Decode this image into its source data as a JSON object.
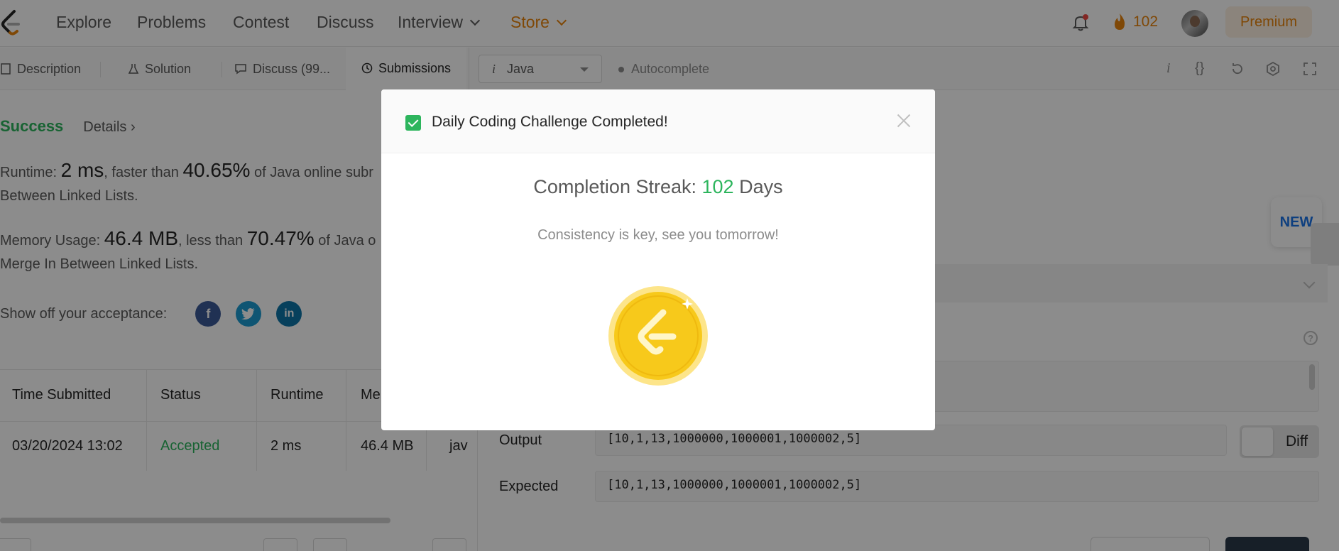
{
  "nav": {
    "items": [
      {
        "label": "Explore"
      },
      {
        "label": "Problems"
      },
      {
        "label": "Contest"
      },
      {
        "label": "Discuss"
      },
      {
        "label": "Interview"
      },
      {
        "label": "Store"
      }
    ],
    "streak_count": "102",
    "premium_label": "Premium",
    "icons": {
      "logo": "leetcode-logo",
      "bell": "bell-icon",
      "fire": "fire-icon"
    },
    "accent_color": "#e8830b"
  },
  "left_tabs": [
    {
      "label": "Description"
    },
    {
      "label": "Solution"
    },
    {
      "label": "Discuss (99..."
    },
    {
      "label": "Submissions"
    }
  ],
  "result": {
    "status": "Success",
    "details_label": "Details",
    "runtime_prefix": "Runtime:",
    "runtime_value": "2 ms",
    "runtime_mid": ", faster than",
    "runtime_pct": "40.65%",
    "runtime_suffix": "of Java online subr",
    "runtime_line2": "Between Linked Lists.",
    "memory_prefix": "Memory Usage:",
    "memory_value": "46.4 MB",
    "memory_mid": ", less than",
    "memory_pct": "70.47%",
    "memory_suffix": "of Java o",
    "memory_line2": "Merge In Between Linked Lists.",
    "share_label": "Show off your acceptance:",
    "status_color": "#2db55d"
  },
  "submissions_table": {
    "headers": [
      "Time Submitted",
      "Status",
      "Runtime",
      "Me"
    ],
    "rows": [
      {
        "time": "03/20/2024 13:02",
        "status": "Accepted",
        "runtime": "2 ms",
        "memory": "46.4 MB",
        "lang": "jav"
      }
    ]
  },
  "editor": {
    "language": "Java",
    "autocomplete_label": "Autocomplete",
    "new_badge": "NEW",
    "output_label": "Output",
    "output_value": "[10,1,13,1000000,1000001,1000002,5]",
    "expected_label": "Expected",
    "expected_value": "[10,1,13,1000000,1000001,1000002,5]",
    "diff_label": "Diff"
  },
  "modal": {
    "title": "Daily Coding Challenge Completed!",
    "streak_prefix": "Completion Streak:",
    "streak_value": "102",
    "streak_suffix": "Days",
    "subtext": "Consistency is key, see you tomorrow!",
    "coin_icon": "leetcode-coin-icon"
  }
}
